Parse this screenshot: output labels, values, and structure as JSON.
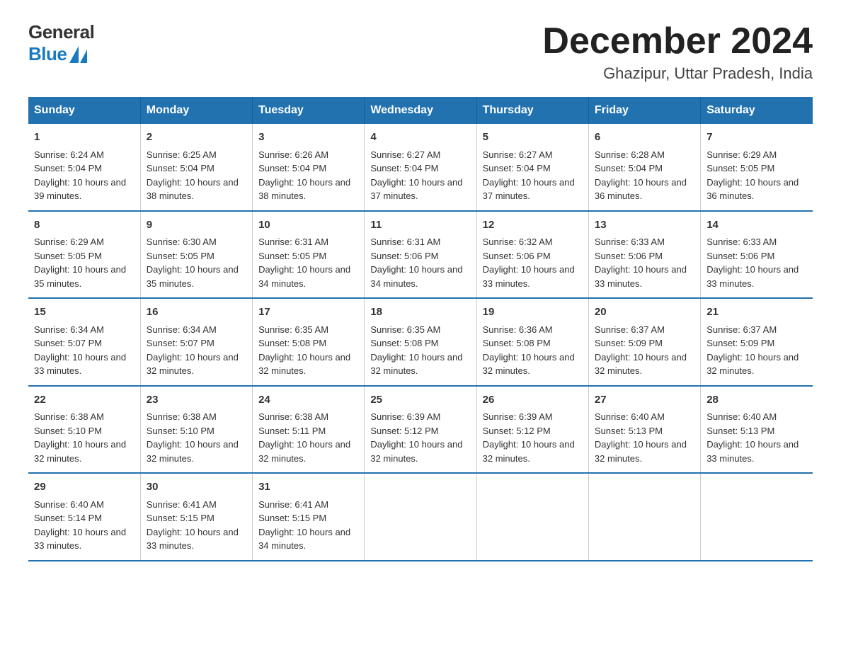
{
  "logo": {
    "general": "General",
    "blue": "Blue"
  },
  "title": "December 2024",
  "location": "Ghazipur, Uttar Pradesh, India",
  "days_of_week": [
    "Sunday",
    "Monday",
    "Tuesday",
    "Wednesday",
    "Thursday",
    "Friday",
    "Saturday"
  ],
  "weeks": [
    [
      {
        "day": "1",
        "sunrise": "6:24 AM",
        "sunset": "5:04 PM",
        "daylight": "10 hours and 39 minutes."
      },
      {
        "day": "2",
        "sunrise": "6:25 AM",
        "sunset": "5:04 PM",
        "daylight": "10 hours and 38 minutes."
      },
      {
        "day": "3",
        "sunrise": "6:26 AM",
        "sunset": "5:04 PM",
        "daylight": "10 hours and 38 minutes."
      },
      {
        "day": "4",
        "sunrise": "6:27 AM",
        "sunset": "5:04 PM",
        "daylight": "10 hours and 37 minutes."
      },
      {
        "day": "5",
        "sunrise": "6:27 AM",
        "sunset": "5:04 PM",
        "daylight": "10 hours and 37 minutes."
      },
      {
        "day": "6",
        "sunrise": "6:28 AM",
        "sunset": "5:04 PM",
        "daylight": "10 hours and 36 minutes."
      },
      {
        "day": "7",
        "sunrise": "6:29 AM",
        "sunset": "5:05 PM",
        "daylight": "10 hours and 36 minutes."
      }
    ],
    [
      {
        "day": "8",
        "sunrise": "6:29 AM",
        "sunset": "5:05 PM",
        "daylight": "10 hours and 35 minutes."
      },
      {
        "day": "9",
        "sunrise": "6:30 AM",
        "sunset": "5:05 PM",
        "daylight": "10 hours and 35 minutes."
      },
      {
        "day": "10",
        "sunrise": "6:31 AM",
        "sunset": "5:05 PM",
        "daylight": "10 hours and 34 minutes."
      },
      {
        "day": "11",
        "sunrise": "6:31 AM",
        "sunset": "5:06 PM",
        "daylight": "10 hours and 34 minutes."
      },
      {
        "day": "12",
        "sunrise": "6:32 AM",
        "sunset": "5:06 PM",
        "daylight": "10 hours and 33 minutes."
      },
      {
        "day": "13",
        "sunrise": "6:33 AM",
        "sunset": "5:06 PM",
        "daylight": "10 hours and 33 minutes."
      },
      {
        "day": "14",
        "sunrise": "6:33 AM",
        "sunset": "5:06 PM",
        "daylight": "10 hours and 33 minutes."
      }
    ],
    [
      {
        "day": "15",
        "sunrise": "6:34 AM",
        "sunset": "5:07 PM",
        "daylight": "10 hours and 33 minutes."
      },
      {
        "day": "16",
        "sunrise": "6:34 AM",
        "sunset": "5:07 PM",
        "daylight": "10 hours and 32 minutes."
      },
      {
        "day": "17",
        "sunrise": "6:35 AM",
        "sunset": "5:08 PM",
        "daylight": "10 hours and 32 minutes."
      },
      {
        "day": "18",
        "sunrise": "6:35 AM",
        "sunset": "5:08 PM",
        "daylight": "10 hours and 32 minutes."
      },
      {
        "day": "19",
        "sunrise": "6:36 AM",
        "sunset": "5:08 PM",
        "daylight": "10 hours and 32 minutes."
      },
      {
        "day": "20",
        "sunrise": "6:37 AM",
        "sunset": "5:09 PM",
        "daylight": "10 hours and 32 minutes."
      },
      {
        "day": "21",
        "sunrise": "6:37 AM",
        "sunset": "5:09 PM",
        "daylight": "10 hours and 32 minutes."
      }
    ],
    [
      {
        "day": "22",
        "sunrise": "6:38 AM",
        "sunset": "5:10 PM",
        "daylight": "10 hours and 32 minutes."
      },
      {
        "day": "23",
        "sunrise": "6:38 AM",
        "sunset": "5:10 PM",
        "daylight": "10 hours and 32 minutes."
      },
      {
        "day": "24",
        "sunrise": "6:38 AM",
        "sunset": "5:11 PM",
        "daylight": "10 hours and 32 minutes."
      },
      {
        "day": "25",
        "sunrise": "6:39 AM",
        "sunset": "5:12 PM",
        "daylight": "10 hours and 32 minutes."
      },
      {
        "day": "26",
        "sunrise": "6:39 AM",
        "sunset": "5:12 PM",
        "daylight": "10 hours and 32 minutes."
      },
      {
        "day": "27",
        "sunrise": "6:40 AM",
        "sunset": "5:13 PM",
        "daylight": "10 hours and 32 minutes."
      },
      {
        "day": "28",
        "sunrise": "6:40 AM",
        "sunset": "5:13 PM",
        "daylight": "10 hours and 33 minutes."
      }
    ],
    [
      {
        "day": "29",
        "sunrise": "6:40 AM",
        "sunset": "5:14 PM",
        "daylight": "10 hours and 33 minutes."
      },
      {
        "day": "30",
        "sunrise": "6:41 AM",
        "sunset": "5:15 PM",
        "daylight": "10 hours and 33 minutes."
      },
      {
        "day": "31",
        "sunrise": "6:41 AM",
        "sunset": "5:15 PM",
        "daylight": "10 hours and 34 minutes."
      },
      null,
      null,
      null,
      null
    ]
  ],
  "labels": {
    "sunrise": "Sunrise:",
    "sunset": "Sunset:",
    "daylight": "Daylight:"
  }
}
